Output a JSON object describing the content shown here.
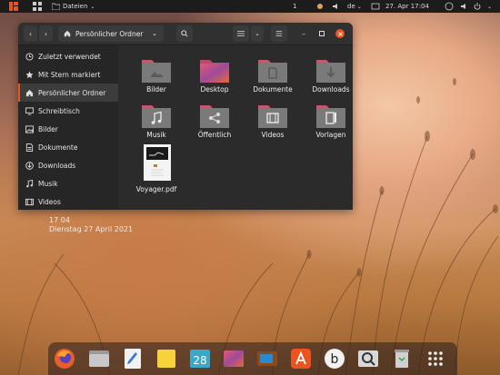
{
  "topbar": {
    "app_menu": "Dateien",
    "workspace": "1",
    "keyboard_layout": "de",
    "clock": "27. Apr  17:04"
  },
  "window": {
    "path": "Persönlicher Ordner",
    "sidebar": [
      {
        "label": "Zuletzt verwendet",
        "icon": "clock-icon"
      },
      {
        "label": "Mit Stern markiert",
        "icon": "star-icon"
      },
      {
        "label": "Persönlicher Ordner",
        "icon": "home-icon",
        "active": true
      },
      {
        "label": "Schreibtisch",
        "icon": "desktop-icon"
      },
      {
        "label": "Bilder",
        "icon": "image-icon"
      },
      {
        "label": "Dokumente",
        "icon": "document-icon"
      },
      {
        "label": "Downloads",
        "icon": "download-icon"
      },
      {
        "label": "Musik",
        "icon": "music-icon"
      },
      {
        "label": "Videos",
        "icon": "video-icon"
      }
    ],
    "files": [
      {
        "label": "Bilder",
        "type": "folder-pictures"
      },
      {
        "label": "Desktop",
        "type": "folder-desktop"
      },
      {
        "label": "Dokumente",
        "type": "folder-documents"
      },
      {
        "label": "Downloads",
        "type": "folder-downloads"
      },
      {
        "label": "Musik",
        "type": "folder-music"
      },
      {
        "label": "Öffentlich",
        "type": "folder-public"
      },
      {
        "label": "Videos",
        "type": "folder-videos"
      },
      {
        "label": "Vorlagen",
        "type": "folder-templates"
      },
      {
        "label": "Voyager.pdf",
        "type": "pdf"
      }
    ]
  },
  "desktop_widget": {
    "time": "17 04",
    "date": "Dienstag 27 April 2021"
  },
  "dock": [
    "firefox-icon",
    "files-icon",
    "text-editor-icon",
    "notes-icon",
    "calendar-icon",
    "desktop-folder-icon",
    "tv-icon",
    "software-center-icon",
    "b-app-icon",
    "screenshot-icon",
    "trash-icon",
    "show-apps-icon"
  ],
  "colors": {
    "accent": "#e95420",
    "folder_gray": "#7a7a7a",
    "folder_tab": "#c05a6a",
    "window_bg": "#2b2b2b",
    "topbar_bg": "#1c1c1c"
  }
}
